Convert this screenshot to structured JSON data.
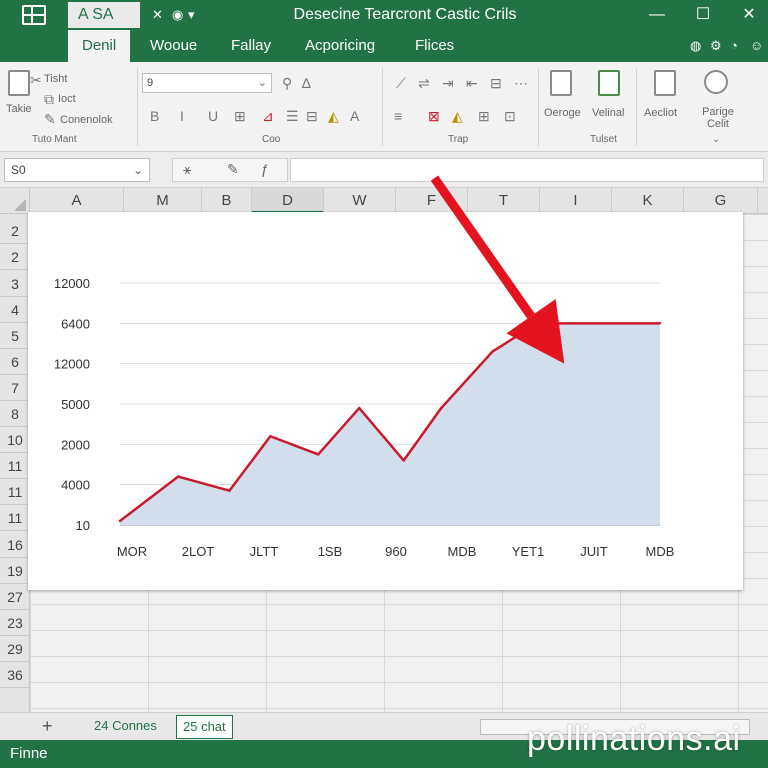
{
  "window": {
    "title": "Desecine Tearcront Castic Crils",
    "quick_access": "A SA",
    "controls": [
      "—",
      "☐",
      "✕"
    ]
  },
  "tabs": [
    {
      "label": "Denil",
      "active": true
    },
    {
      "label": "Wooue"
    },
    {
      "label": "Fallay"
    },
    {
      "label": "Acporicing"
    },
    {
      "label": "Flices"
    }
  ],
  "ribbon": {
    "clipboard": {
      "paste": "Takie",
      "items": [
        "Tisht",
        "Ioct",
        "Conenolok"
      ],
      "group_label": "Tuto Mant"
    },
    "font": {
      "name_value": "9",
      "group_label": "Coo"
    },
    "alignment": {
      "group_label": "Trap"
    },
    "styles": {
      "buttons": [
        "Oeroge",
        "Velinal"
      ],
      "group_label": "Tulset"
    },
    "cells": {
      "buttons": [
        "Aecliot",
        "Parige Celit"
      ]
    }
  },
  "formula_bar": {
    "name_box": "S0"
  },
  "columns": [
    "A",
    "M",
    "B",
    "D",
    "W",
    "F",
    "T",
    "I",
    "K",
    "G"
  ],
  "rows": [
    "2",
    "2",
    "3",
    "4",
    "5",
    "6",
    "7",
    "8",
    "10",
    "11",
    "11",
    "11",
    "16",
    "19",
    "27",
    "23",
    "29",
    "36"
  ],
  "chart_data": {
    "type": "area",
    "title": "",
    "xlabel": "",
    "ylabel": "",
    "y_tick_labels": [
      "12000",
      "6400",
      "12000",
      "5000",
      "2000",
      "4000",
      "10"
    ],
    "x_tick_labels": [
      "MOR",
      "2LOT",
      "JLTT",
      "1SB",
      "960",
      "MDB",
      "YET1",
      "JUIT",
      "MDB"
    ],
    "ylim": [
      0,
      6
    ],
    "x": [
      0,
      0.85,
      1.6,
      2.2,
      2.9,
      3.5,
      4.15,
      4.7,
      5.45,
      6.1,
      6.6,
      7.9
    ],
    "y": [
      0.1,
      1.2,
      0.85,
      2.2,
      1.75,
      2.9,
      1.6,
      2.9,
      4.3,
      5.0,
      5.0,
      5.0
    ],
    "grid": true,
    "colors": {
      "line": "#c8192d",
      "fill": "#d2deeb",
      "arrow": "#e3141f"
    },
    "annotation": {
      "type": "arrow",
      "from": [
        4.6,
        8.6
      ],
      "to": [
        6.5,
        4.0
      ]
    }
  },
  "sheets": [
    {
      "label": "24 Connes"
    },
    {
      "label": "25 chat",
      "active": true
    }
  ],
  "status": {
    "text": "Finne"
  },
  "watermark": "pollinations.ai"
}
